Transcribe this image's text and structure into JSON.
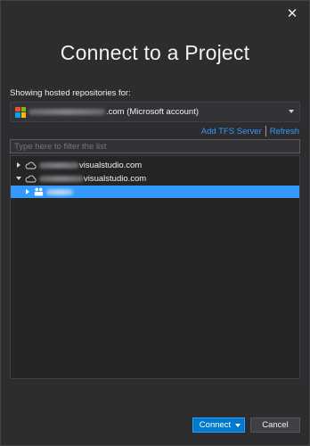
{
  "dialog": {
    "close_glyph": "✕",
    "title": "Connect to a Project"
  },
  "account": {
    "section_label": "Showing hosted repositories for:",
    "selected_suffix": ".com (Microsoft account)",
    "icon": "microsoft-logo"
  },
  "actions": {
    "add_tfs_server": "Add TFS Server",
    "refresh": "Refresh"
  },
  "filter": {
    "placeholder": "Type here to filter the list"
  },
  "tree": {
    "items": [
      {
        "label_suffix": "visualstudio.com",
        "expanded": false,
        "icon": "cloud-icon"
      },
      {
        "label_suffix": "visualstudio.com",
        "expanded": true,
        "icon": "cloud-icon"
      },
      {
        "label_suffix": "",
        "expanded": false,
        "icon": "team-project-icon",
        "selected": true
      }
    ]
  },
  "footer": {
    "connect_label": "Connect",
    "cancel_label": "Cancel"
  },
  "colors": {
    "background": "#2d2d30",
    "accent": "#007acc",
    "link": "#3399ff",
    "selection": "#3399ff"
  }
}
